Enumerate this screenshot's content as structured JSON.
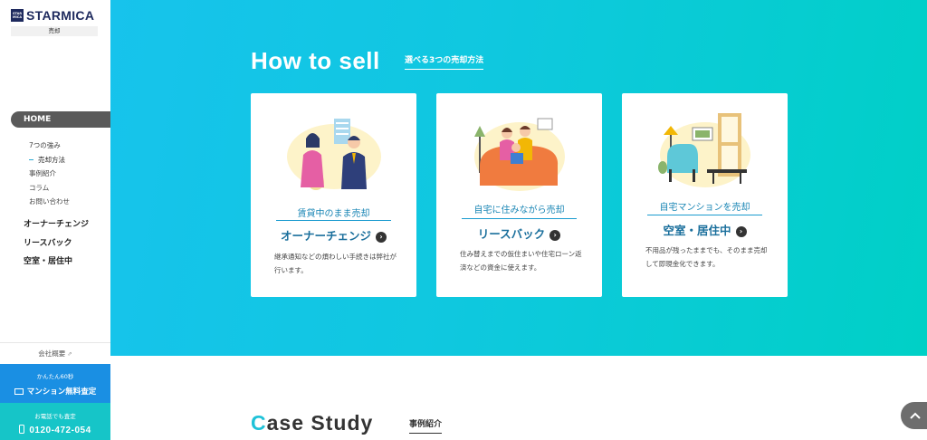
{
  "brand": {
    "mark": "STAR MICA",
    "name": "STARMICA",
    "section": "売却"
  },
  "sidebar": {
    "home": "HOME",
    "sub_items": [
      {
        "label": "7つの強み",
        "active": false
      },
      {
        "label": "売却方法",
        "active": true
      },
      {
        "label": "事例紹介",
        "active": false
      },
      {
        "label": "コラム",
        "active": false
      },
      {
        "label": "お問い合わせ",
        "active": false
      }
    ],
    "main_items": [
      "オーナーチェンジ",
      "リースバック",
      "空室・居住中"
    ],
    "company": "会社概要",
    "cta_web": {
      "small": "かんたん60秒",
      "big": "マンション無料査定"
    },
    "cta_phone": {
      "small": "お電話でも査定",
      "big": "0120-472-054"
    }
  },
  "how_to_sell": {
    "title": "How to sell",
    "subtitle": "選べる3つの売却方法",
    "cards": [
      {
        "category": "賃貸中のまま売却",
        "name": "オーナーチェンジ",
        "desc": "継承通知などの煩わしい手続きは弊社が行います。"
      },
      {
        "category": "自宅に住みながら売却",
        "name": "リースバック",
        "desc": "住み替えまでの仮住まいや住宅ローン返済などの資金に使えます。"
      },
      {
        "category": "自宅マンションを売却",
        "name": "空室・居住中",
        "desc": "不用品が残ったままでも、そのまま売却して即現金化できます。"
      }
    ]
  },
  "case_study": {
    "title_first": "C",
    "title_rest": "ase Study",
    "subtitle": "事例紹介"
  },
  "colors": {
    "brand_navy": "#1e2a5e",
    "hero_start": "#17c3ec",
    "hero_end": "#00d0c6",
    "cta_blue": "#1a8fe3",
    "cta_teal": "#16c5c8"
  }
}
